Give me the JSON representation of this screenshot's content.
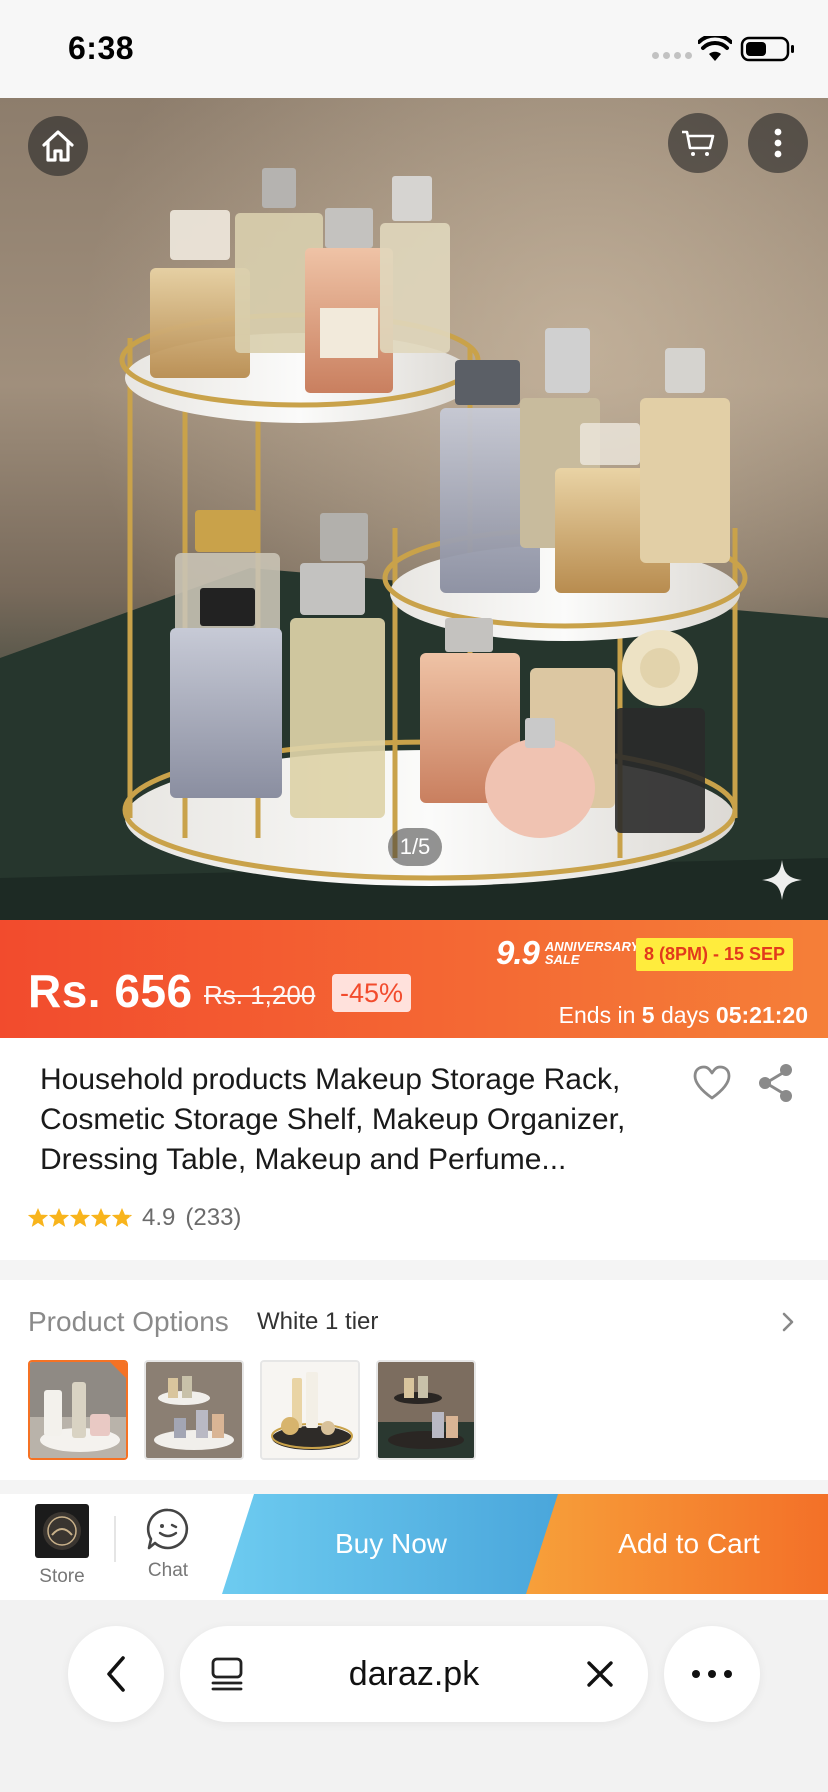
{
  "status_bar": {
    "time": "6:38"
  },
  "hero": {
    "image_counter": "1/5"
  },
  "price": {
    "current": "Rs. 656",
    "original": "Rs. 1,200",
    "discount": "-45%",
    "sale_title": "9.9",
    "sale_subtitle": "ANNIVERSARY SALE",
    "sale_dates": "8 (8PM) - 15 SEP",
    "countdown_prefix": "Ends in",
    "countdown_days": "5",
    "countdown_days_label": "days",
    "countdown_time": "05:21:20"
  },
  "product": {
    "title": "Household products Makeup Storage Rack, Cosmetic Storage Shelf, Makeup Organizer, Dressing Table, Makeup and Perfume...",
    "rating": "4.9",
    "rating_count": "(233)",
    "rating_stars": 4.9
  },
  "options": {
    "label": "Product Options",
    "value": "White 1 tier",
    "selected_index": 0,
    "thumbnail_count": 4
  },
  "actions": {
    "store_label": "Store",
    "chat_label": "Chat",
    "buy_now_label": "Buy Now",
    "add_to_cart_label": "Add to Cart"
  },
  "browser": {
    "url": "daraz.pk"
  },
  "colors": {
    "brand_orange": "#f57224",
    "banner_red": "#f24b2d",
    "buy_now_blue": "#4aa6db",
    "sale_yellow": "#ffec3d",
    "star_gold": "#f8b41c"
  },
  "icons": [
    "home-icon",
    "cart-icon",
    "more-vertical-icon",
    "sparkle-icon",
    "heart-icon",
    "share-icon",
    "star-icon",
    "chevron-right-icon",
    "chat-icon",
    "back-icon",
    "tabs-icon",
    "close-icon",
    "more-horizontal-icon",
    "wifi-icon",
    "battery-icon"
  ]
}
